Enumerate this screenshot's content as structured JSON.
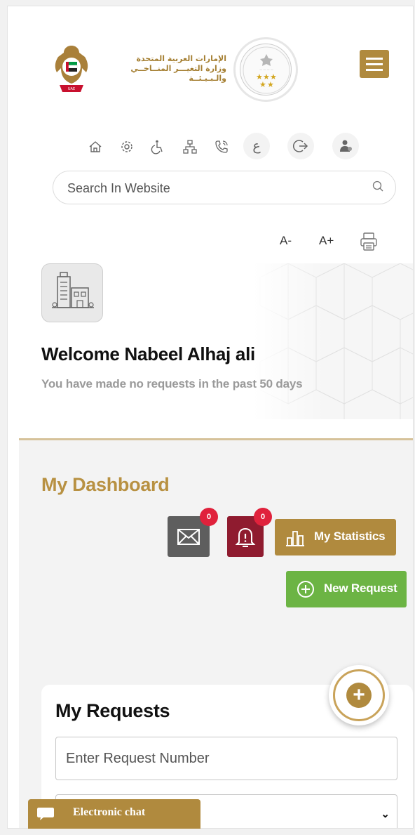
{
  "header": {
    "ministry_name_ar": [
      "الإمارات العربية المتحدة",
      "وزارة التغيـــر المنــاخــي",
      "والـبـيـئــة"
    ],
    "emblem_icon": "uae-emblem-icon",
    "award_icon": "award-badge-icon",
    "menu_icon": "hamburger-menu-icon"
  },
  "toolbar": {
    "icons": [
      "home-icon",
      "settings-icon",
      "accessibility-icon",
      "sitemap-icon",
      "phone-icon",
      "arabic-language-icon",
      "logout-icon",
      "user-icon"
    ],
    "arabic_label": "ع"
  },
  "search": {
    "placeholder": "Search In Website"
  },
  "font_controls": {
    "decrease": "A-",
    "increase": "A+"
  },
  "welcome": {
    "title": "Welcome Nabeel Alhaj ali",
    "subtitle": "You have made no requests in the past 50 days"
  },
  "dashboard": {
    "title": "My Dashboard",
    "mail_count": "0",
    "notification_count": "0",
    "statistics_label": "My Statistics",
    "new_request_label": "New Request"
  },
  "requests": {
    "title": "My Requests",
    "request_number_placeholder": "Enter Request Number"
  },
  "chat": {
    "label": "Electronic chat"
  },
  "colors": {
    "gold": "#b08a3e",
    "green": "#6cb444",
    "maroon": "#8f1b2f",
    "badge_red": "#e0223c",
    "grey": "#5e5e5e"
  }
}
